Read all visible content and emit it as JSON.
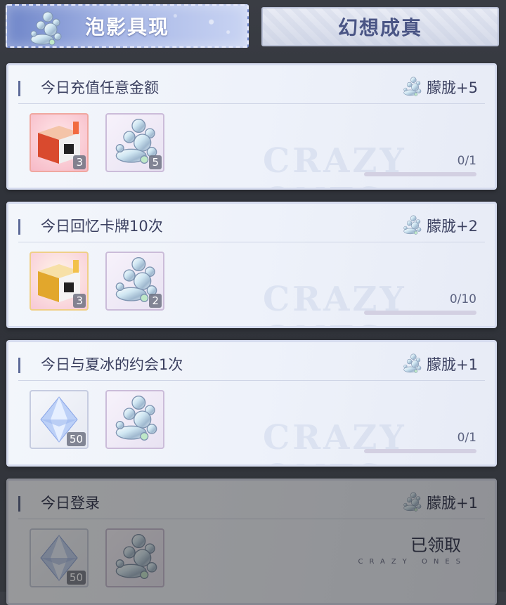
{
  "tabs": [
    {
      "label": "泡影具现",
      "active": true,
      "icon": "bubble-cluster-icon"
    },
    {
      "label": "幻想成真",
      "active": false
    }
  ],
  "tasks": [
    {
      "title": "今日充值任意金额",
      "reward": "朦胧+5",
      "reward_icon": "bubble-cluster-icon",
      "items": [
        {
          "icon": "red-gift-box-icon",
          "count": "3"
        },
        {
          "icon": "bubble-cluster-icon",
          "count": "5"
        }
      ],
      "progress": "0/1",
      "progress_fraction": 0
    },
    {
      "title": "今日回忆卡牌10次",
      "reward": "朦胧+2",
      "reward_icon": "bubble-cluster-icon",
      "items": [
        {
          "icon": "gold-gift-box-icon",
          "count": "3"
        },
        {
          "icon": "bubble-cluster-icon",
          "count": "2"
        }
      ],
      "progress": "0/10",
      "progress_fraction": 0
    },
    {
      "title": "今日与夏冰的约会1次",
      "reward": "朦胧+1",
      "reward_icon": "bubble-cluster-icon",
      "items": [
        {
          "icon": "blue-crystal-icon",
          "count": "50"
        },
        {
          "icon": "bubble-cluster-icon",
          "count": ""
        }
      ],
      "progress": "0/1",
      "progress_fraction": 0
    },
    {
      "title": "今日登录",
      "reward": "朦胧+1",
      "reward_icon": "bubble-cluster-icon",
      "items": [
        {
          "icon": "blue-crystal-icon",
          "count": "50"
        },
        {
          "icon": "bubble-cluster-icon",
          "count": ""
        }
      ],
      "status": "已领取",
      "status_sub": "CRAZY ONES"
    }
  ],
  "watermark": "CRAZY ONES"
}
